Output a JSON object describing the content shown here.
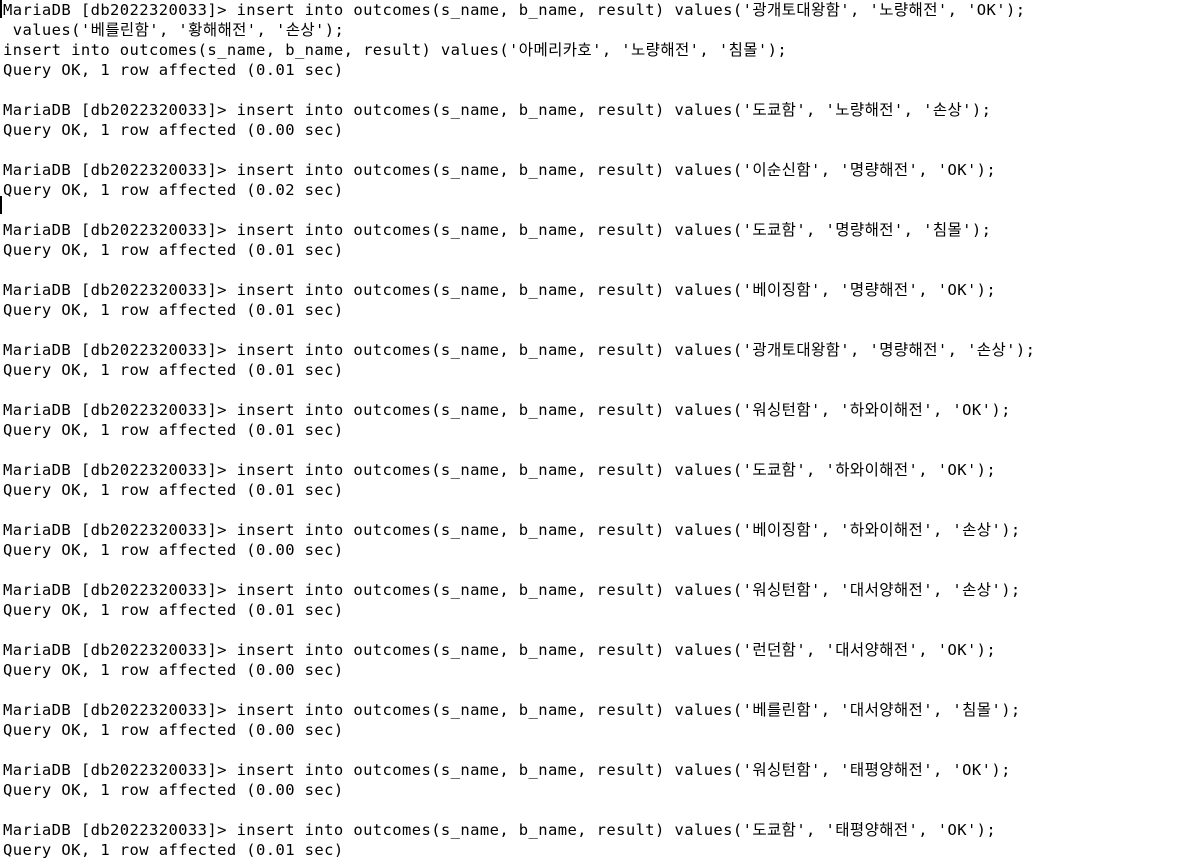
{
  "terminal": {
    "lines": [
      "MariaDB [db2022320033]> insert into outcomes(s_name, b_name, result) values('광개토대왕함', '노량해전', 'OK');",
      " values('베를린함', '황해해전', '손상');",
      "insert into outcomes(s_name, b_name, result) values('아메리카호', '노량해전', '침몰');",
      "Query OK, 1 row affected (0.01 sec)",
      "",
      "MariaDB [db2022320033]> insert into outcomes(s_name, b_name, result) values('도쿄함', '노량해전', '손상');",
      "Query OK, 1 row affected (0.00 sec)",
      "",
      "MariaDB [db2022320033]> insert into outcomes(s_name, b_name, result) values('이순신함', '명량해전', 'OK');",
      "Query OK, 1 row affected (0.02 sec)",
      "",
      "MariaDB [db2022320033]> insert into outcomes(s_name, b_name, result) values('도쿄함', '명량해전', '침몰');",
      "Query OK, 1 row affected (0.01 sec)",
      "",
      "MariaDB [db2022320033]> insert into outcomes(s_name, b_name, result) values('베이징함', '명량해전', 'OK');",
      "Query OK, 1 row affected (0.01 sec)",
      "",
      "MariaDB [db2022320033]> insert into outcomes(s_name, b_name, result) values('광개토대왕함', '명량해전', '손상');",
      "Query OK, 1 row affected (0.01 sec)",
      "",
      "MariaDB [db2022320033]> insert into outcomes(s_name, b_name, result) values('워싱턴함', '하와이해전', 'OK');",
      "Query OK, 1 row affected (0.01 sec)",
      "",
      "MariaDB [db2022320033]> insert into outcomes(s_name, b_name, result) values('도쿄함', '하와이해전', 'OK');",
      "Query OK, 1 row affected (0.01 sec)",
      "",
      "MariaDB [db2022320033]> insert into outcomes(s_name, b_name, result) values('베이징함', '하와이해전', '손상');",
      "Query OK, 1 row affected (0.00 sec)",
      "",
      "MariaDB [db2022320033]> insert into outcomes(s_name, b_name, result) values('워싱턴함', '대서양해전', '손상');",
      "Query OK, 1 row affected (0.01 sec)",
      "",
      "MariaDB [db2022320033]> insert into outcomes(s_name, b_name, result) values('런던함', '대서양해전', 'OK');",
      "Query OK, 1 row affected (0.00 sec)",
      "",
      "MariaDB [db2022320033]> insert into outcomes(s_name, b_name, result) values('베를린함', '대서양해전', '침몰');",
      "Query OK, 1 row affected (0.00 sec)",
      "",
      "MariaDB [db2022320033]> insert into outcomes(s_name, b_name, result) values('워싱턴함', '태평양해전', 'OK');",
      "Query OK, 1 row affected (0.00 sec)",
      "",
      "MariaDB [db2022320033]> insert into outcomes(s_name, b_name, result) values('도쿄함', '태평양해전', 'OK');",
      "Query OK, 1 row affected (0.01 sec)"
    ]
  }
}
